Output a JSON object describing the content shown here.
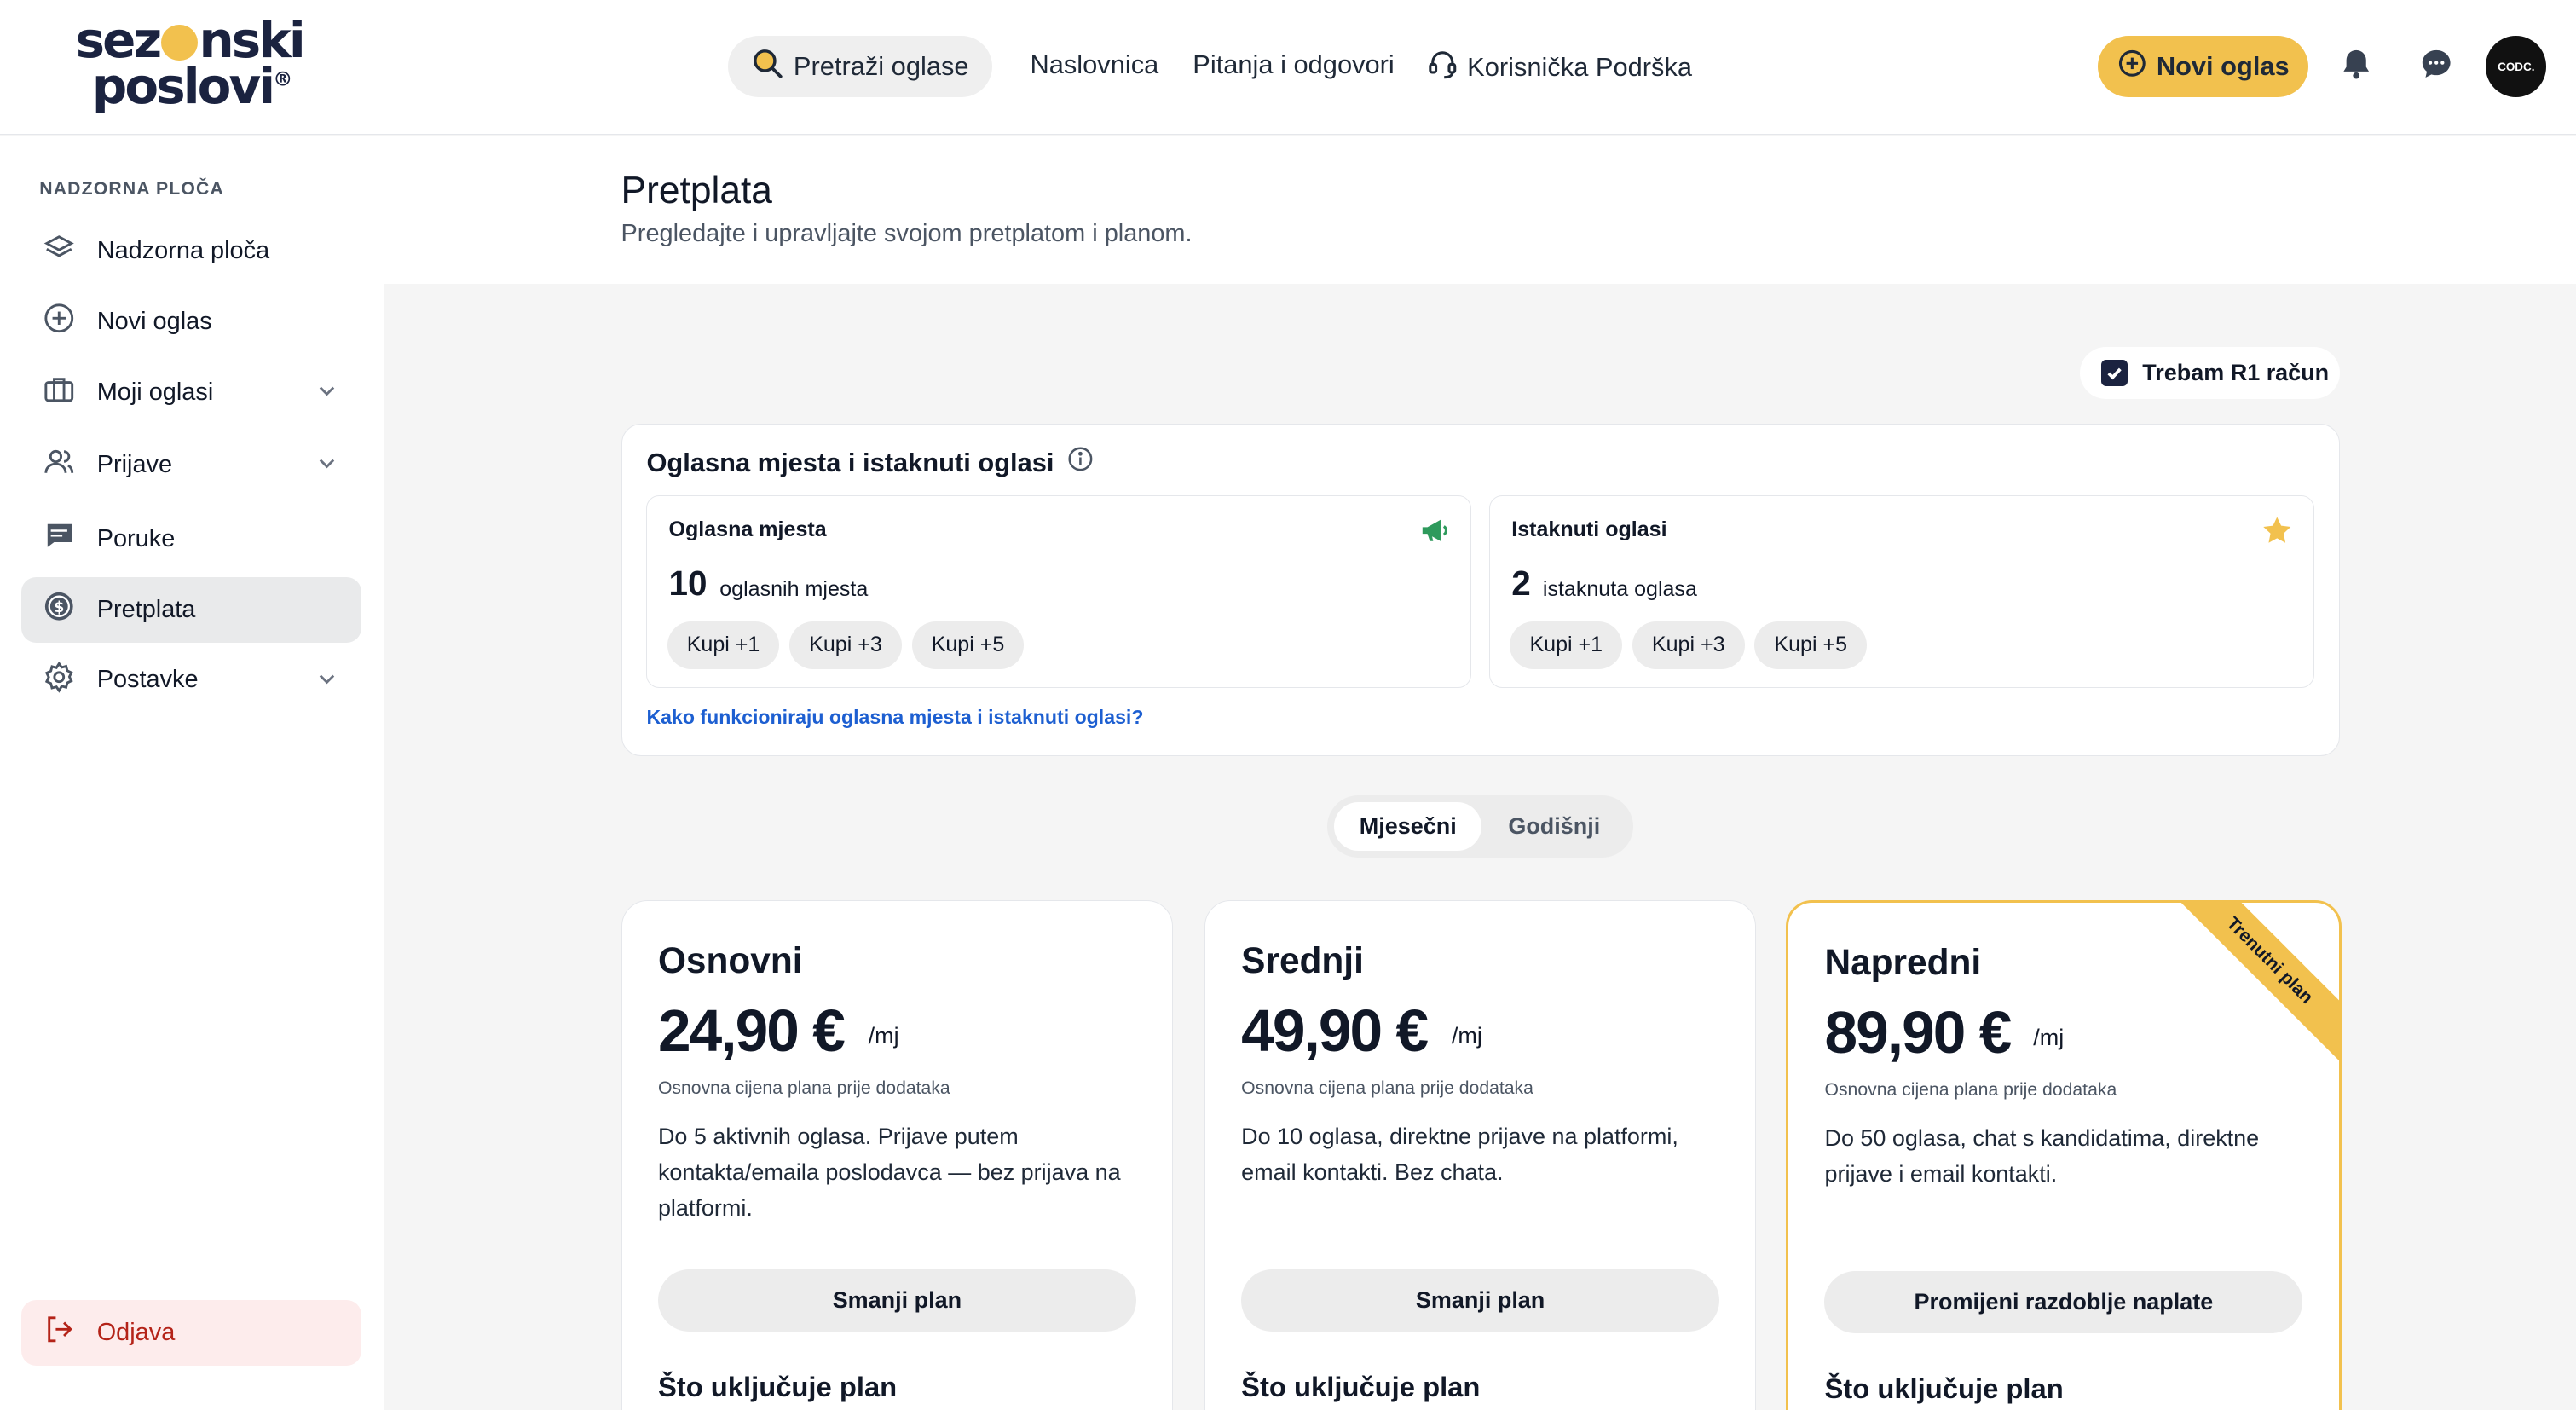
{
  "header": {
    "logo_line1_a": "sez",
    "logo_line1_b": "nski",
    "logo_line2": "poslovi",
    "logo_reg": "®",
    "search_label": "Pretraži oglase",
    "nav": [
      "Naslovnica",
      "Pitanja i odgovori"
    ],
    "support_label": "Korisnička Podrška",
    "new_ad_label": "Novi oglas",
    "avatar_text": "CODC."
  },
  "sidebar": {
    "heading": "NADZORNA PLOČA",
    "items": [
      {
        "label": "Nadzorna ploča",
        "icon": "layers-icon"
      },
      {
        "label": "Novi oglas",
        "icon": "plus-circle-icon"
      },
      {
        "label": "Moji oglasi",
        "icon": "briefcase-icon"
      },
      {
        "label": "Prijave",
        "icon": "users-icon"
      },
      {
        "label": "Poruke",
        "icon": "message-icon"
      },
      {
        "label": "Pretplata",
        "icon": "coin-icon"
      },
      {
        "label": "Postavke",
        "icon": "gear-icon"
      }
    ],
    "logout_label": "Odjava"
  },
  "page": {
    "title": "Pretplata",
    "subtitle": "Pregledajte i upravljajte svojom pretplatom i planom."
  },
  "r1": {
    "label": "Trebam R1 račun",
    "checked": true
  },
  "slots": {
    "title": "Oglasna mjesta i istaknuti oglasi",
    "cards": [
      {
        "title": "Oglasna mjesta",
        "count": "10",
        "unit": "oglasnih mjesta",
        "buy": [
          "Kupi +1",
          "Kupi +3",
          "Kupi +5"
        ]
      },
      {
        "title": "Istaknuti oglasi",
        "count": "2",
        "unit": "istaknuta oglasa",
        "buy": [
          "Kupi +1",
          "Kupi +3",
          "Kupi +5"
        ]
      }
    ],
    "link": "Kako funkcioniraju oglasna mjesta i istaknuti oglasi?"
  },
  "billing_toggle": {
    "options": [
      "Mjesečni",
      "Godišnji"
    ],
    "selected": "Mjesečni"
  },
  "plans": [
    {
      "name": "Osnovni",
      "price": "24,90 €",
      "period": "/mj",
      "base_note": "Osnovna cijena plana prije dodataka",
      "description": "Do 5 aktivnih oglasa. Prijave putem kontakta/emaila poslodavca — bez prijava na platformi.",
      "button": "Smanji plan",
      "includes_heading": "Što uključuje plan"
    },
    {
      "name": "Srednji",
      "price": "49,90 €",
      "period": "/mj",
      "base_note": "Osnovna cijena plana prije dodataka",
      "description": "Do 10 oglasa, direktne prijave na platformi, email kontakti. Bez chata.",
      "button": "Smanji plan",
      "includes_heading": "Što uključuje plan"
    },
    {
      "name": "Napredni",
      "price": "89,90 €",
      "period": "/mj",
      "base_note": "Osnovna cijena plana prije dodataka",
      "description": "Do 50 oglasa, chat s kandidatima, direktne prijave i email kontakti.",
      "button": "Promijeni razdoblje naplate",
      "includes_heading": "Što uključuje plan",
      "ribbon": "Trenutni plan"
    }
  ],
  "colors": {
    "accent": "#f2c14e",
    "brand": "#1b2340",
    "link": "#1d5fd1",
    "logout": "#b42318"
  }
}
